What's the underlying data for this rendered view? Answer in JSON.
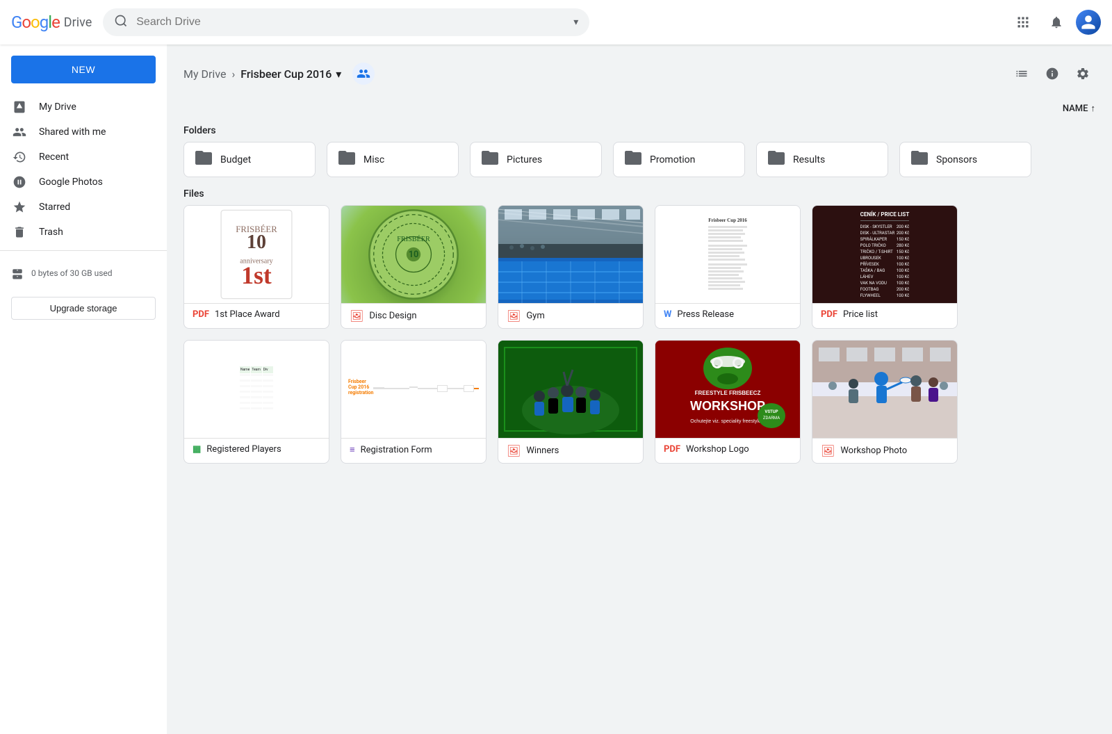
{
  "header": {
    "logo_text": "Google",
    "app_name": "Drive",
    "search_placeholder": "Search Drive",
    "apps_icon": "⊞",
    "notifications_icon": "🔔",
    "account_icon": "👤"
  },
  "sidebar": {
    "new_button": "NEW",
    "items": [
      {
        "id": "my-drive",
        "label": "My Drive",
        "icon": "drive"
      },
      {
        "id": "shared-with-me",
        "label": "Shared with me",
        "icon": "people"
      },
      {
        "id": "recent",
        "label": "Recent",
        "icon": "clock"
      },
      {
        "id": "google-photos",
        "label": "Google Photos",
        "icon": "photos"
      },
      {
        "id": "starred",
        "label": "Starred",
        "icon": "star"
      },
      {
        "id": "trash",
        "label": "Trash",
        "icon": "trash"
      }
    ],
    "storage_text": "0 bytes of 30 GB used",
    "upgrade_label": "Upgrade storage"
  },
  "breadcrumb": {
    "parent": "My Drive",
    "current": "Frisbeer Cup 2016",
    "dropdown_icon": "▾"
  },
  "sort": {
    "label": "NAME",
    "direction": "↑"
  },
  "sections": {
    "folders_label": "Folders",
    "files_label": "Files"
  },
  "folders": [
    {
      "id": "budget",
      "name": "Budget"
    },
    {
      "id": "misc",
      "name": "Misc"
    },
    {
      "id": "pictures",
      "name": "Pictures"
    },
    {
      "id": "promotion",
      "name": "Promotion"
    },
    {
      "id": "results",
      "name": "Results"
    },
    {
      "id": "sponsors",
      "name": "Sponsors"
    }
  ],
  "files": [
    {
      "id": "1st-place-award",
      "name": "1st Place Award",
      "type": "pdf",
      "type_color": "#ea4335"
    },
    {
      "id": "disc-design",
      "name": "Disc Design",
      "type": "image",
      "type_color": "#ea4335"
    },
    {
      "id": "gym",
      "name": "Gym",
      "type": "image",
      "type_color": "#ea4335"
    },
    {
      "id": "press-release",
      "name": "Press Release",
      "type": "doc",
      "type_color": "#4285f4"
    },
    {
      "id": "price-list",
      "name": "Price list",
      "type": "pdf",
      "type_color": "#ea4335"
    },
    {
      "id": "registered-players",
      "name": "Registered Players",
      "type": "sheets",
      "type_color": "#34a853"
    },
    {
      "id": "registration-form",
      "name": "Registration Form",
      "type": "doc",
      "type_color": "#673ab7"
    },
    {
      "id": "winners",
      "name": "Winners",
      "type": "image",
      "type_color": "#ea4335"
    },
    {
      "id": "workshop-logo",
      "name": "Workshop Logo",
      "type": "pdf",
      "type_color": "#ea4335"
    },
    {
      "id": "workshop-photo",
      "name": "Workshop Photo",
      "type": "image",
      "type_color": "#ea4335"
    }
  ]
}
